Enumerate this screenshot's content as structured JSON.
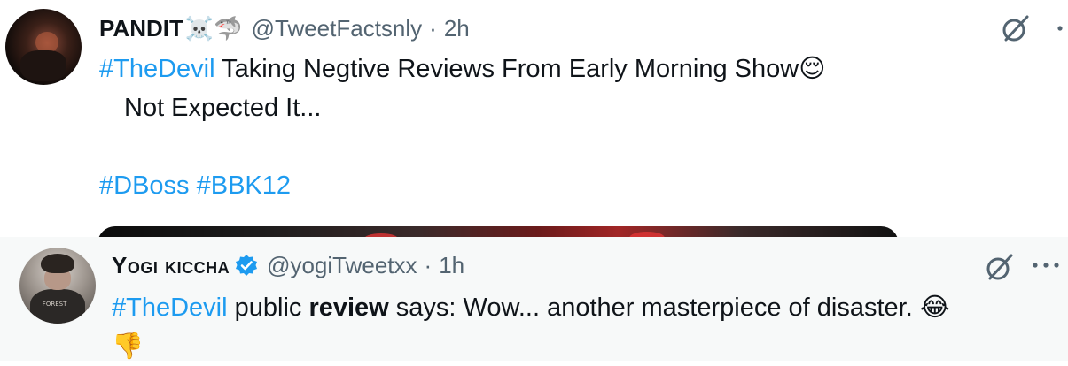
{
  "tweets": [
    {
      "display_name": "PANDIT",
      "name_badges": "☠️🦈",
      "handle": "@TweetFactsnly",
      "separator": "·",
      "time": "2h",
      "text": {
        "hashtag1": "#TheDevil",
        "line1_rest": " Taking Negtive Reviews From Early Morning Show",
        "emoji1": "😌",
        "line2": "Not Expected It...",
        "hashtag2": "#DBoss",
        "hashtag3": "#BBK12"
      }
    },
    {
      "display_name": "Yogi kiccha",
      "handle": "@yogiTweetxx",
      "separator": "·",
      "time": "1h",
      "avatar_shirt_text": "FOREST",
      "text": {
        "hashtag1": "#TheDevil",
        "part1": " public ",
        "bold": "review",
        "part2": " says: Wow... another masterpiece of disaster. ",
        "emoji1": "😂",
        "emoji2": "👎"
      }
    }
  ],
  "colors": {
    "hashtag": "#1d9bf0",
    "secondary": "#536471",
    "verified": "#1d9bf0",
    "quoted_bg": "#f7f9f9"
  },
  "icons": [
    "grok-icon",
    "more-icon",
    "verified-badge-icon"
  ]
}
